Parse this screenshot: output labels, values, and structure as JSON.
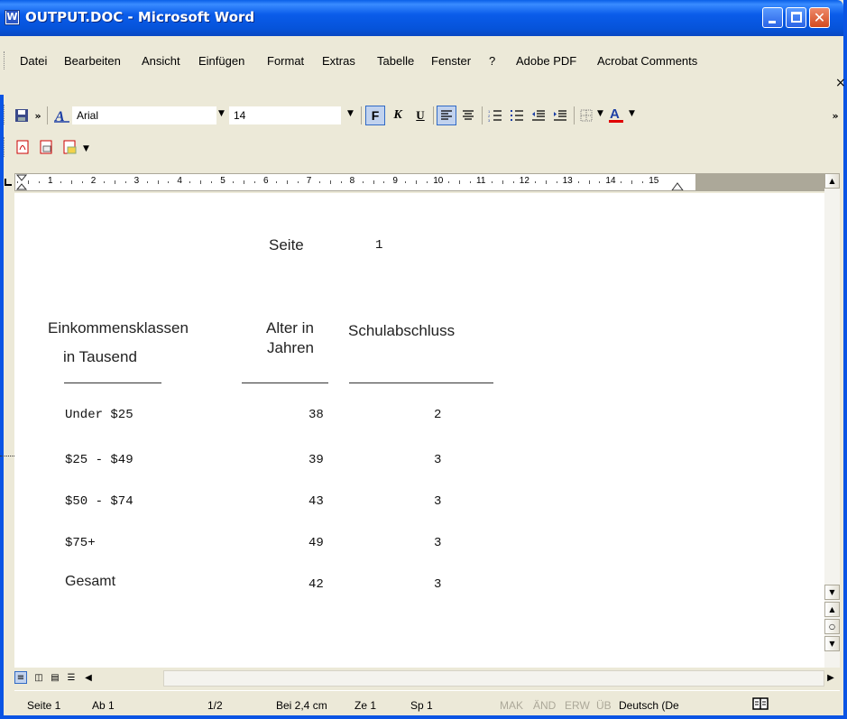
{
  "window": {
    "title": "OUTPUT.DOC - Microsoft Word"
  },
  "menu": {
    "items": [
      "Datei",
      "Bearbeiten",
      "Ansicht",
      "Einfügen",
      "Format",
      "Extras",
      "Tabelle",
      "Fenster",
      "?",
      "Adobe PDF",
      "Acrobat Comments"
    ],
    "close_glyph": "×"
  },
  "toolbar": {
    "font_name": "Arial",
    "font_size": "14",
    "bold_label": "F",
    "italic_label": "K",
    "underline_label": "U"
  },
  "ruler": {
    "numbers": [
      "1",
      "2",
      "3",
      "4",
      "5",
      "6",
      "7",
      "8",
      "9",
      "10",
      "11",
      "12",
      "13",
      "14",
      "15"
    ]
  },
  "document": {
    "page_label": "Seite",
    "page_number": "1",
    "headers": {
      "col1_line1": "Einkommensklassen",
      "col1_line2": "in Tausend",
      "col2_line1": "Alter in",
      "col2_line2": "Jahren",
      "col3": "Schulabschluss"
    },
    "rows": [
      {
        "label": "Under $25",
        "age": "38",
        "school": "2"
      },
      {
        "label": "$25 - $49",
        "age": "39",
        "school": "3"
      },
      {
        "label": "$50 - $74",
        "age": "43",
        "school": "3"
      },
      {
        "label": "$75+",
        "age": "49",
        "school": "3"
      },
      {
        "label": "Gesamt",
        "age": "42",
        "school": "3"
      }
    ]
  },
  "status": {
    "page": "Seite 1",
    "section": "Ab 1",
    "pages": "1/2",
    "position": "Bei 2,4 cm",
    "line": "Ze 1",
    "column": "Sp 1",
    "mak": "MAK",
    "aend": "ÄND",
    "erw": "ERW",
    "ueb": "ÜB",
    "language": "Deutsch (De"
  },
  "colors": {
    "titlebar": "#0A5CEA",
    "chrome": "#ECE9D8",
    "font_color_bar": "#e00000"
  }
}
